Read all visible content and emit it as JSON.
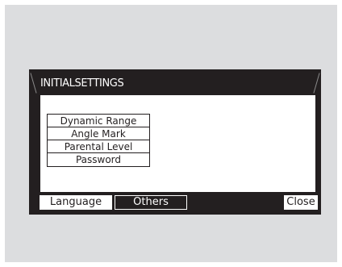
{
  "window": {
    "title": "INITIALSETTINGS"
  },
  "menu": {
    "items": [
      {
        "label": "Dynamic Range"
      },
      {
        "label": "Angle Mark"
      },
      {
        "label": "Parental Level"
      },
      {
        "label": "Password"
      }
    ]
  },
  "tabs": {
    "language_label": "Language",
    "others_label": "Others",
    "selected": "Others"
  },
  "footer": {
    "close_label": "Close"
  },
  "colors": {
    "background": "#dcdddf",
    "screen": "#231f20",
    "panel": "#ffffff"
  }
}
